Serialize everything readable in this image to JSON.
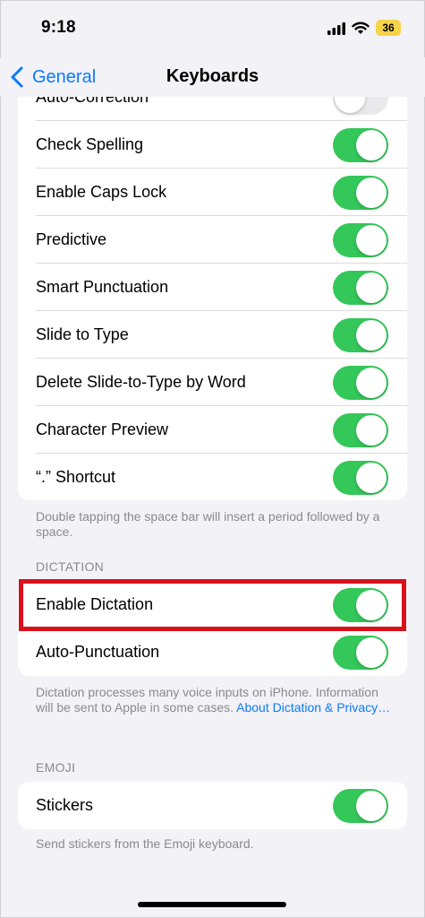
{
  "status_bar": {
    "time": "9:18",
    "battery": "36"
  },
  "nav": {
    "back_label": "General",
    "title": "Keyboards"
  },
  "top_group": {
    "partial_row": {
      "label": "Auto-Correction",
      "on": false
    },
    "rows": [
      {
        "label": "Check Spelling",
        "on": true
      },
      {
        "label": "Enable Caps Lock",
        "on": true
      },
      {
        "label": "Predictive",
        "on": true
      },
      {
        "label": "Smart Punctuation",
        "on": true
      },
      {
        "label": "Slide to Type",
        "on": true
      },
      {
        "label": "Delete Slide-to-Type by Word",
        "on": true
      },
      {
        "label": "Character Preview",
        "on": true
      },
      {
        "label": "“.” Shortcut",
        "on": true
      }
    ],
    "footer": "Double tapping the space bar will insert a period followed by a space."
  },
  "dictation": {
    "header": "DICTATION",
    "rows": [
      {
        "label": "Enable Dictation",
        "on": true
      },
      {
        "label": "Auto-Punctuation",
        "on": true
      }
    ],
    "footer_text": "Dictation processes many voice inputs on iPhone. Information will be sent to Apple in some cases.",
    "footer_link": "About Dictation & Privacy…"
  },
  "emoji": {
    "header": "EMOJI",
    "rows": [
      {
        "label": "Stickers",
        "on": true
      }
    ],
    "footer": "Send stickers from the Emoji keyboard."
  },
  "colors": {
    "accent": "#0a7aff",
    "toggle_on": "#34c759",
    "highlight": "#d8121b",
    "battery": "#f6d44a"
  }
}
